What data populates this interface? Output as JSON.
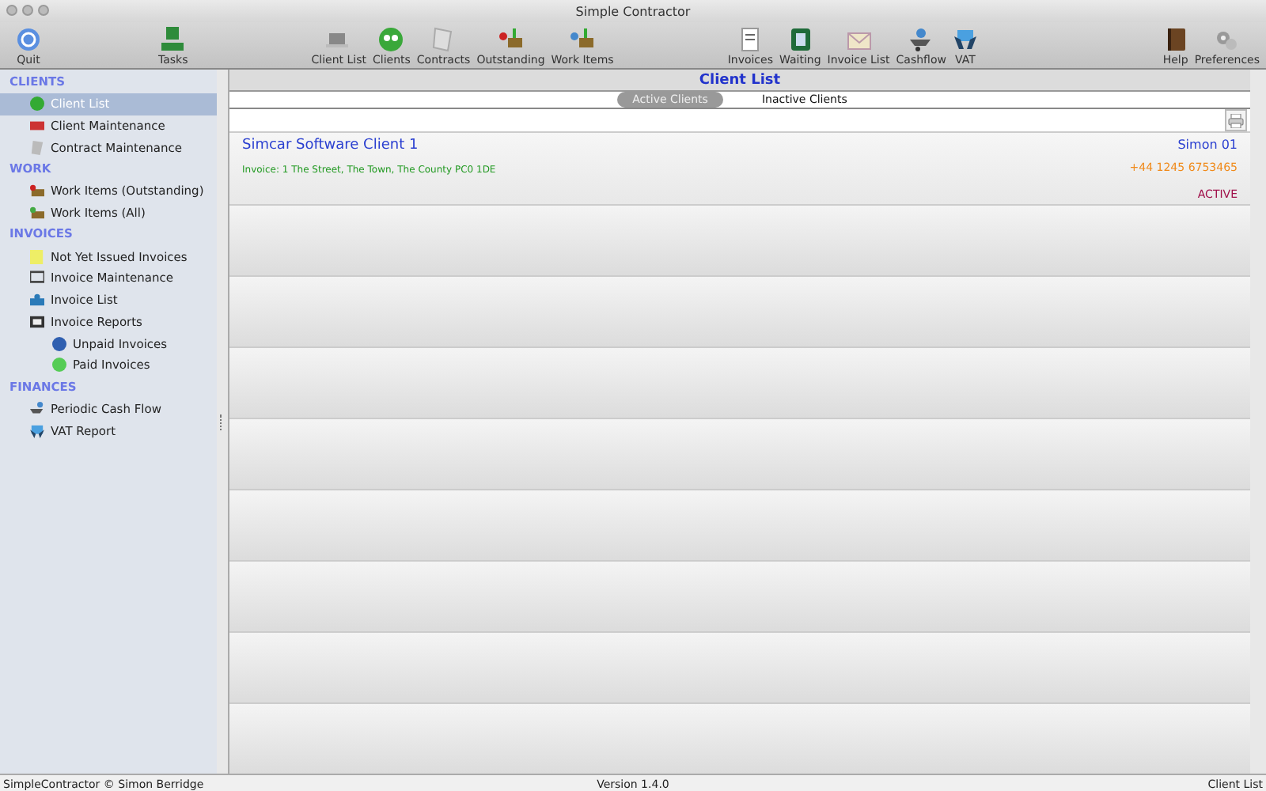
{
  "window": {
    "title": "Simple Contractor"
  },
  "toolbar": [
    [
      {
        "label": "Quit"
      },
      {
        "label": "Tasks"
      }
    ],
    [
      {
        "label": "Client List"
      },
      {
        "label": "Clients"
      },
      {
        "label": "Contracts"
      },
      {
        "label": "Outstanding"
      },
      {
        "label": "Work Items"
      }
    ],
    [
      {
        "label": "Invoices"
      },
      {
        "label": "Waiting"
      },
      {
        "label": "Invoice List"
      },
      {
        "label": "Cashflow"
      },
      {
        "label": "VAT"
      }
    ],
    [
      {
        "label": "Help"
      },
      {
        "label": "Preferences"
      }
    ]
  ],
  "sidebar": {
    "sections": [
      {
        "title": "CLIENTS",
        "items": [
          {
            "label": "Client List",
            "selected": true
          },
          {
            "label": "Client Maintenance",
            "selected": false
          },
          {
            "label": "Contract Maintenance",
            "selected": false
          }
        ]
      },
      {
        "title": "WORK",
        "items": [
          {
            "label": "Work Items (Outstanding)",
            "selected": false
          },
          {
            "label": "Work Items (All)",
            "selected": false
          }
        ]
      },
      {
        "title": "INVOICES",
        "items": [
          {
            "label": "Not Yet Issued Invoices",
            "selected": false
          },
          {
            "label": "Invoice Maintenance",
            "selected": false
          },
          {
            "label": "Invoice List",
            "selected": false
          },
          {
            "label": "Invoice Reports",
            "selected": false,
            "children": [
              {
                "label": "Unpaid Invoices",
                "selected": false
              },
              {
                "label": "Paid Invoices",
                "selected": false
              }
            ]
          }
        ]
      },
      {
        "title": "FINANCES",
        "items": [
          {
            "label": "Periodic Cash Flow",
            "selected": false
          },
          {
            "label": "VAT Report",
            "selected": false
          }
        ]
      }
    ]
  },
  "main": {
    "title": "Client List",
    "tabs": [
      {
        "label": "Active Clients",
        "selected": true
      },
      {
        "label": "Inactive Clients",
        "selected": false
      }
    ],
    "clients": [
      {
        "name": "Simcar Software Client 1",
        "contact": "Simon 01",
        "phone": "+44 1245 6753465",
        "address": "Invoice: 1 The Street, The Town, The County PC0 1DE",
        "status": "ACTIVE"
      }
    ]
  },
  "status_bar": {
    "left": "SimpleContractor © Simon Berridge",
    "center": "Version 1.4.0",
    "right": "Client List"
  }
}
